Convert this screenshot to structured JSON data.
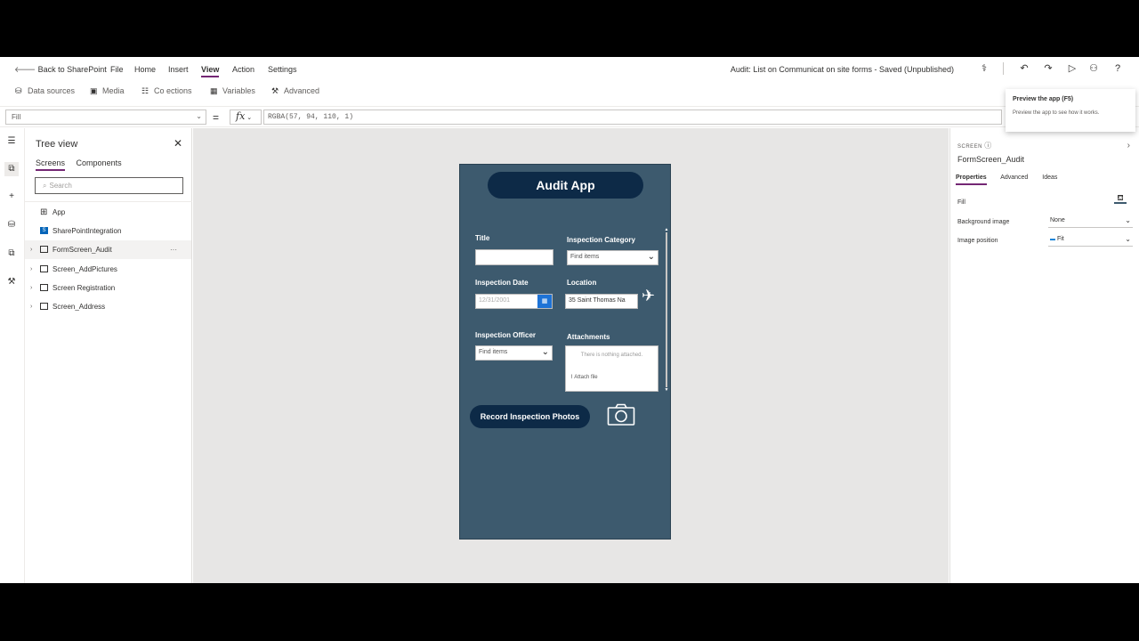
{
  "menubar": {
    "back_label": "Back to SharePoint",
    "items": [
      "File",
      "Home",
      "Insert",
      "View",
      "Action",
      "Settings"
    ],
    "active_item": "View",
    "doc_title": "Audit: List on Communicat on site forms - Saved (Unpublished)"
  },
  "commands": [
    "Data sources",
    "Media",
    "Co ections",
    "Variables",
    "Advanced"
  ],
  "formula_bar": {
    "property": "Fill",
    "equals": "=",
    "fx": "fx",
    "formula": "RGBA(57, 94, 110, 1)"
  },
  "tooltip": {
    "title": "Preview the app (F5)",
    "desc": "Preview the app to see how it works."
  },
  "tree": {
    "title": "Tree view",
    "tabs": [
      "Screens",
      "Components"
    ],
    "active_tab": "Screens",
    "search_placeholder": "Search",
    "items": [
      {
        "label": "App",
        "kind": "app"
      },
      {
        "label": "SharePointIntegration",
        "kind": "sharepoint"
      },
      {
        "label": "FormScreen_Audit",
        "kind": "screen",
        "selected": true
      },
      {
        "label": "Screen_AddPictures",
        "kind": "screen"
      },
      {
        "label": "Screen Registration",
        "kind": "screen"
      },
      {
        "label": "Screen_Address",
        "kind": "screen"
      }
    ],
    "more": "···"
  },
  "app": {
    "title": "Audit App",
    "fields": {
      "title_label": "Title",
      "category_label": "Inspection Category",
      "category_value": "Find items",
      "date_label": "Inspection Date",
      "date_value": "12/31/2001",
      "location_label": "Location",
      "location_value": "35 Saint Thomas Na",
      "officer_label": "Inspection Officer",
      "officer_value": "Find items",
      "attachments_label": "Attachments",
      "attachments_note": "There is nothing attached.",
      "attach_file": "Attach file"
    },
    "record_button": "Record Inspection Photos",
    "screen_fill": "#3d5a6e"
  },
  "properties": {
    "section_label": "SCREEN",
    "screen_name": "FormScreen_Audit",
    "tabs": [
      "Properties",
      "Advanced",
      "Ideas"
    ],
    "active_tab": "Properties",
    "rows": [
      {
        "label": "Fill",
        "value": ""
      },
      {
        "label": "Background image",
        "value": "None"
      },
      {
        "label": "Image position",
        "value": "Fit"
      }
    ]
  }
}
